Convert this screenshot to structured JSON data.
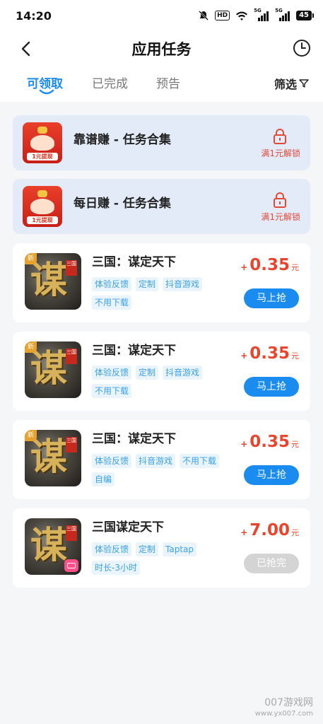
{
  "status": {
    "time": "14:20",
    "battery": "45",
    "hd": "HD",
    "network": "5G"
  },
  "header": {
    "title": "应用任务"
  },
  "tabs": [
    {
      "label": "可领取"
    },
    {
      "label": "已完成"
    },
    {
      "label": "预告"
    }
  ],
  "filter": {
    "label": "筛选"
  },
  "locked_tasks": [
    {
      "title": "靠谱赚 - 任务合集",
      "lock_label": "满1元解锁",
      "icon_text": "1元提现"
    },
    {
      "title": "每日赚 - 任务合集",
      "lock_label": "满1元解锁",
      "icon_text": "1元提现"
    }
  ],
  "tasks": [
    {
      "title": "三国：谋定天下",
      "tags": [
        "体验反馈",
        "定制",
        "抖音游戏",
        "不用下载"
      ],
      "reward_plus": "+",
      "reward": "0.35",
      "unit": "元",
      "button": "马上抢",
      "badge": "新",
      "glyph": "谋",
      "seal": "三国"
    },
    {
      "title": "三国：谋定天下",
      "tags": [
        "体验反馈",
        "定制",
        "抖音游戏",
        "不用下载"
      ],
      "reward_plus": "+",
      "reward": "0.35",
      "unit": "元",
      "button": "马上抢",
      "badge": "新",
      "glyph": "谋",
      "seal": "三国"
    },
    {
      "title": "三国：谋定天下",
      "tags": [
        "体验反馈",
        "抖音游戏",
        "不用下载",
        "自编"
      ],
      "reward_plus": "+",
      "reward": "0.35",
      "unit": "元",
      "button": "马上抢",
      "badge": "新",
      "glyph": "谋",
      "seal": "三国"
    },
    {
      "title": "三国谋定天下",
      "tags": [
        "体验反馈",
        "定制",
        "Taptap",
        "时长-3小时"
      ],
      "reward_plus": "+",
      "reward": "7.00",
      "unit": "元",
      "button": "已抢完",
      "glyph": "谋",
      "seal": "三国"
    }
  ],
  "watermark": {
    "line1": "007游戏网",
    "line2": "www.yx007.com"
  }
}
